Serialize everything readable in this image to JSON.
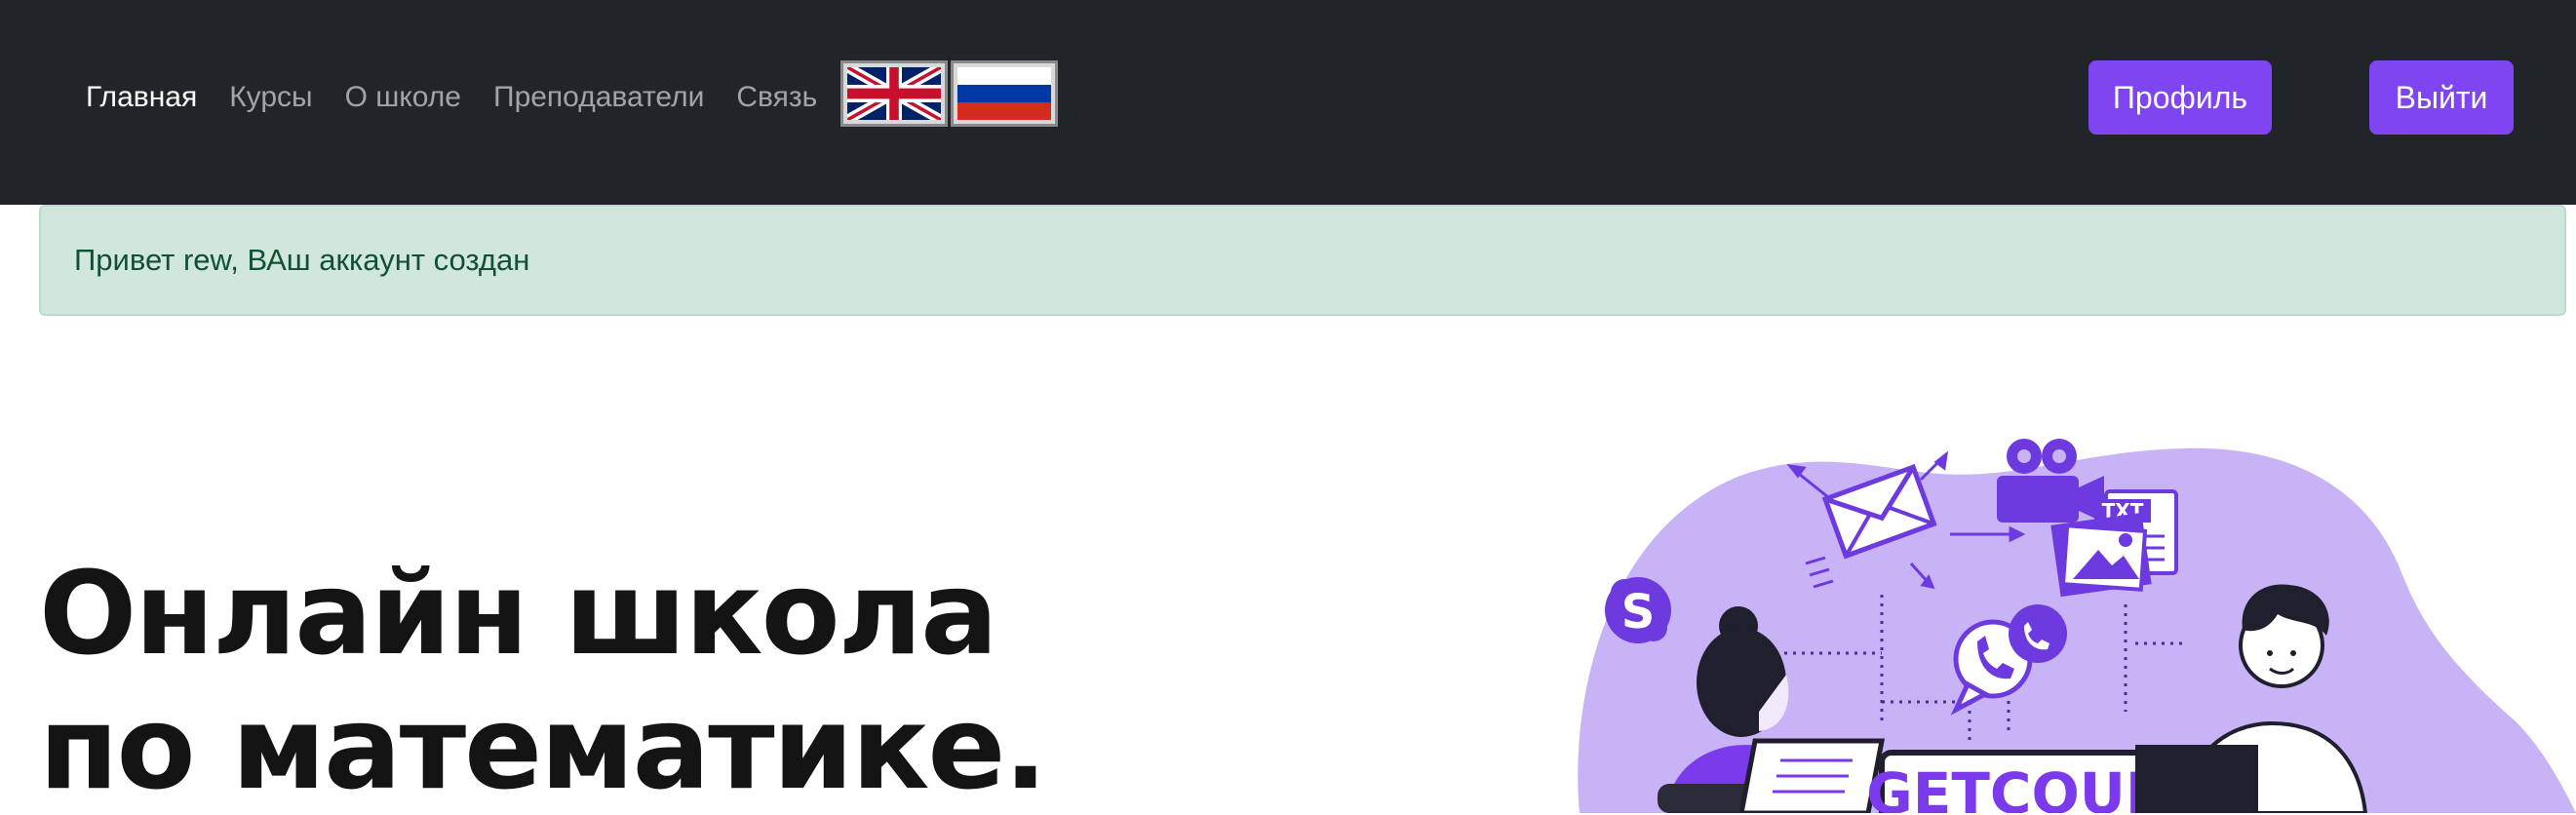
{
  "nav": {
    "links": [
      "Главная",
      "Курсы",
      "О школе",
      "Преподаватели",
      "Связь"
    ],
    "flags": [
      "uk-flag-icon",
      "ru-flag-icon"
    ],
    "profile_label": "Профиль",
    "logout_label": "Выйти"
  },
  "alert": {
    "message": "Привет rew, ВАш аккаунт создан"
  },
  "hero": {
    "title_line1": "Онлайн школа",
    "title_line2": "по математике.",
    "illustration": {
      "brand": "GETCOURSE",
      "file_label": "TXT",
      "icons": [
        "skype-icon",
        "mail-icon",
        "video-camera-icon",
        "txt-file-icon",
        "image-icon",
        "viber-icon"
      ]
    }
  },
  "colors": {
    "navbar_bg": "#212529",
    "accent": "#7e45f0",
    "alert_bg": "#d1e7dd",
    "alert_text": "#0f5132",
    "illustration_bg": "#c9b3f7"
  }
}
